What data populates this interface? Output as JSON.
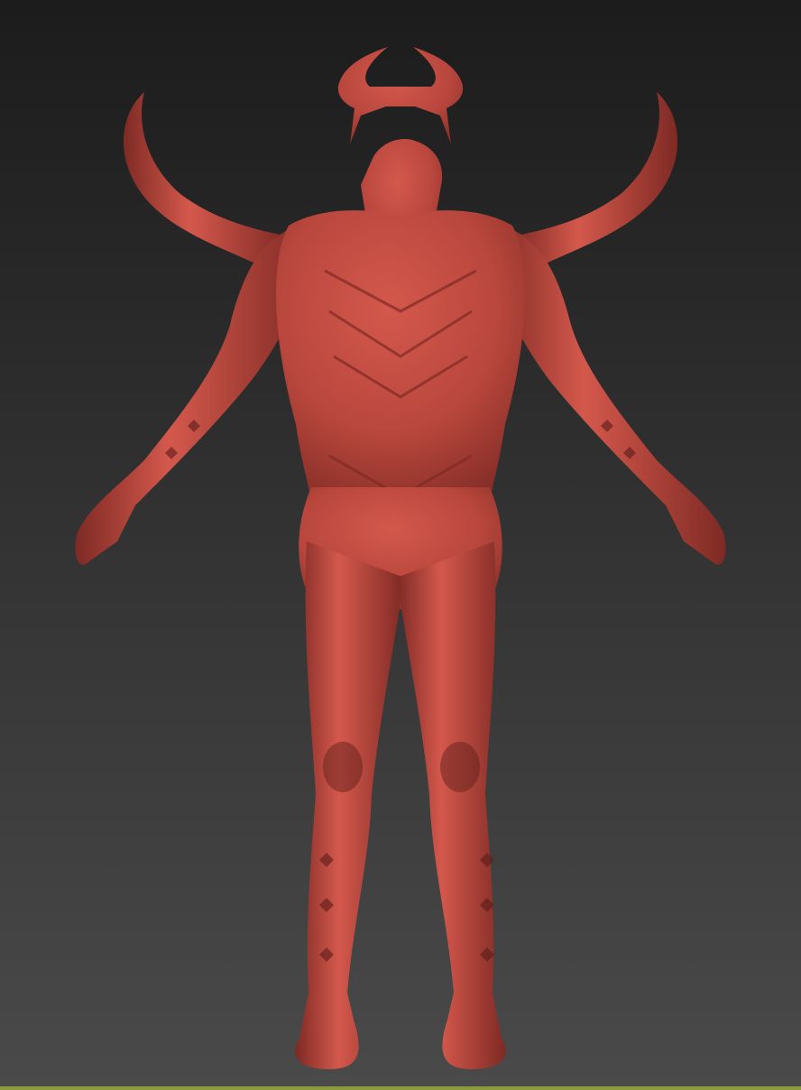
{
  "viewport": {
    "background_top": "#1c1c1c",
    "background_bottom": "#4a4a4a",
    "strip_color": "#8a9a3a"
  },
  "model": {
    "clay_light": "#d4584c",
    "clay_mid": "#b9473d",
    "clay_dark": "#7e2a24",
    "clay_shadow": "#5a1c18"
  }
}
